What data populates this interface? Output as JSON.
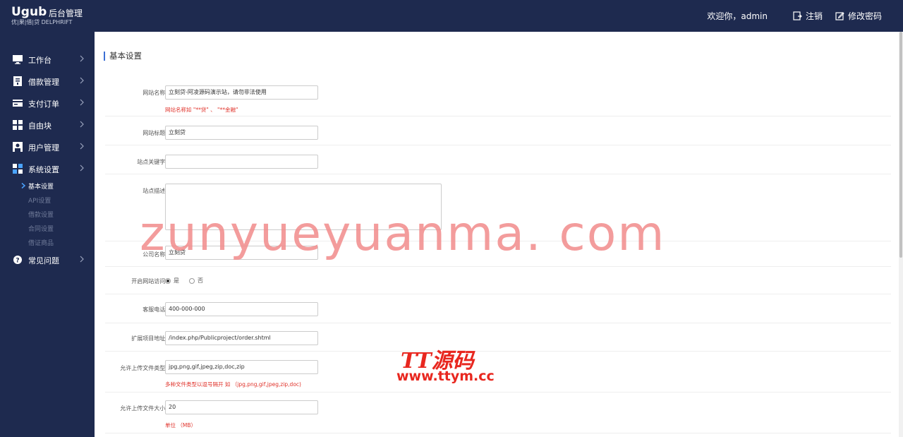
{
  "header": {
    "logo_main": "Ugub",
    "logo_admin": "后台管理",
    "logo_sub": "优|果|借|贷 DELPHRIFT",
    "welcome": "欢迎你，admin",
    "logout_label": "注销",
    "change_password_label": "修改密码"
  },
  "sidebar": {
    "items": [
      {
        "label": "工作台",
        "icon": "monitor-icon"
      },
      {
        "label": "借款管理",
        "icon": "document-icon"
      },
      {
        "label": "支付订单",
        "icon": "card-icon"
      },
      {
        "label": "自由块",
        "icon": "grid-icon"
      },
      {
        "label": "用户管理",
        "icon": "user-icon"
      },
      {
        "label": "系统设置",
        "icon": "windows-icon"
      },
      {
        "label": "常见问题",
        "icon": "help-icon"
      }
    ],
    "sub_items": [
      {
        "label": "基本设置",
        "active": true
      },
      {
        "label": "API设置",
        "active": false
      },
      {
        "label": "借款设置",
        "active": false
      },
      {
        "label": "合同设置",
        "active": false
      },
      {
        "label": "借证商品",
        "active": false
      }
    ]
  },
  "page": {
    "title": "基本设置"
  },
  "form": {
    "site_name_label": "网站名称:",
    "site_name_value": "立刻贷-阿凌源码演示站，请勿非法使用",
    "site_name_hint": "网站名称如 \"**贷\" 、 \"**金融\"",
    "site_title_label": "网站标题:",
    "site_title_value": "立刻贷",
    "keywords_label": "站点关键字:",
    "keywords_value": "",
    "description_label": "站点描述:",
    "description_value": "",
    "company_label": "公司名称:",
    "company_value": "立刻贷",
    "open_site_label": "开启网站访问:",
    "open_yes": "是",
    "open_no": "否",
    "phone_label": "客服电话:",
    "phone_value": "400-000-000",
    "ext_url_label": "扩展项目地址:",
    "ext_url_value": "/index.php/Publicproject/order.shtml",
    "file_types_label": "允许上传文件类型:",
    "file_types_value": "jpg,png,gif,jpeg,zip,doc,zip",
    "file_types_hint": "多种文件类型以逗号隔开 如 （jpg,png,gif,jpeg,zip,doc)",
    "file_size_label": "允许上传文件大小:",
    "file_size_value": "20",
    "file_size_hint": "单位 （MB）"
  },
  "watermark": {
    "main": "zunyueyuanma. com",
    "brand": "TT源码",
    "url": "www.ttym.cc"
  },
  "colors": {
    "sidebar_bg": "#1e2a4f",
    "hint_red": "#e0322a",
    "watermark_pink": "#f28b8b"
  }
}
